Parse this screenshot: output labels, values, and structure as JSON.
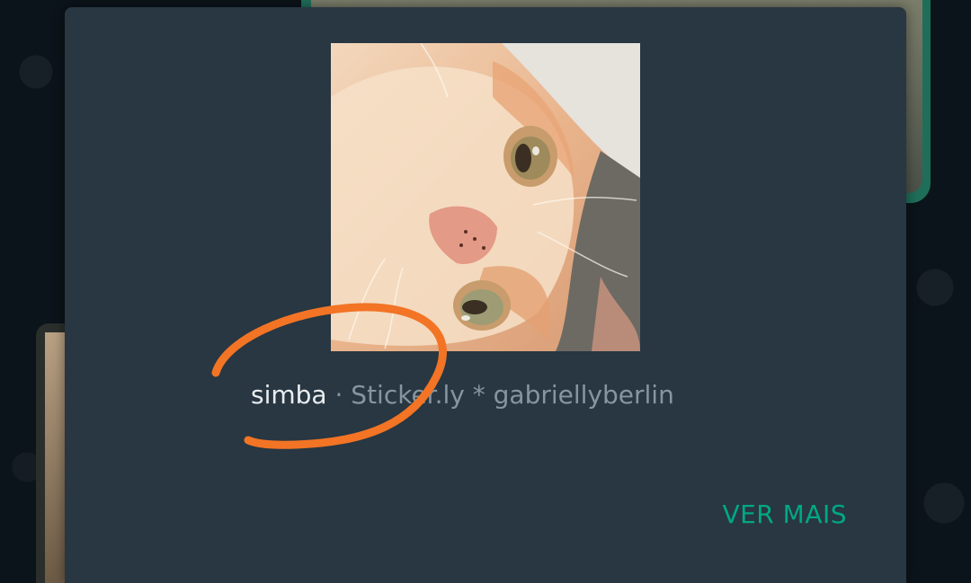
{
  "sticker_pack": {
    "name": "simba",
    "separator": "·",
    "source": "Sticker.ly * gabriellyberlin",
    "more_label": "VER MAIS",
    "sticker_icon": "cat-sticker-image"
  },
  "colors": {
    "dialog_bg": "#283742",
    "accent": "#00a884",
    "annotation": "#f27424"
  }
}
